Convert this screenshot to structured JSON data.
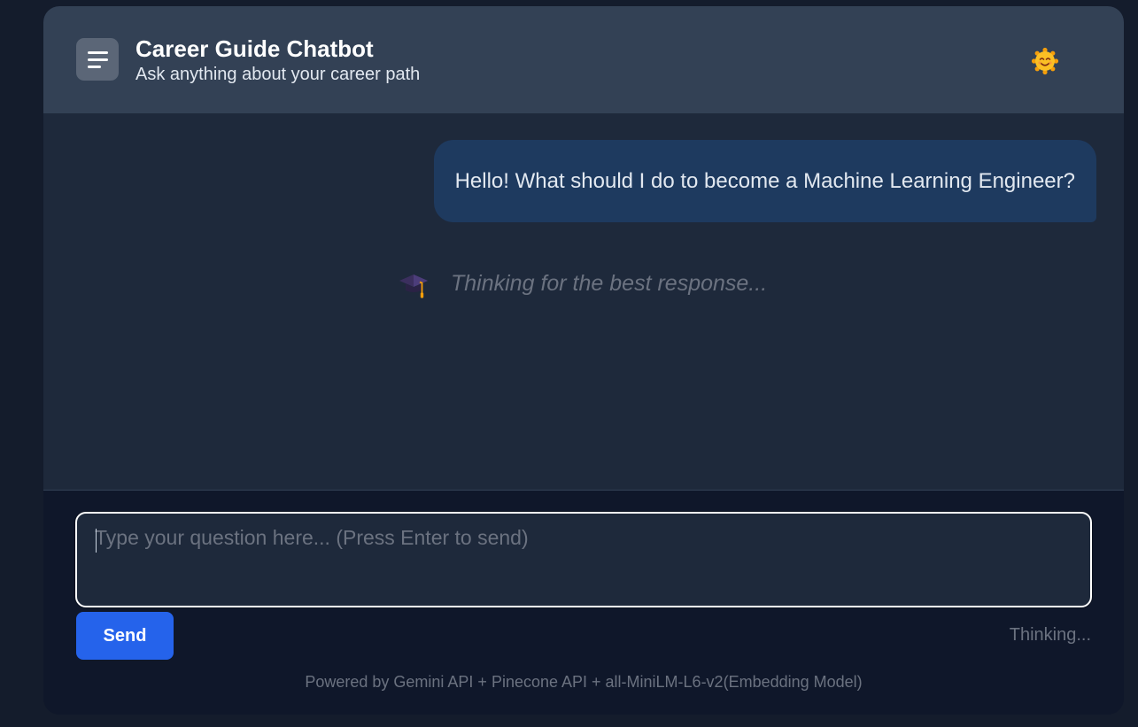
{
  "header": {
    "menu_icon": "hamburger-menu-icon",
    "title": "Career Guide Chatbot",
    "subtitle": "Ask anything about your career path",
    "theme_icon": "smiling-sun-icon"
  },
  "chat": {
    "messages": [
      {
        "role": "user",
        "text": "Hello! What should I do to become a Machine Learning Engineer?"
      }
    ],
    "thinking": {
      "icon": "graduation-cap-icon",
      "text": "Thinking for the best response..."
    }
  },
  "input": {
    "placeholder": "Type your question here... (Press Enter to send)",
    "value": ""
  },
  "send_label": "Send",
  "status": "Thinking...",
  "footer": "Powered by Gemini API + Pinecone API + all-MiniLM-L6-v2(Embedding Model)",
  "colors": {
    "page_bg": "#141c2c",
    "app_bg": "#0f172a",
    "header_bg": "#334155",
    "chat_bg": "#1e293b",
    "user_bubble_bg": "#1e3a5f",
    "accent": "#2563eb",
    "muted_text": "#6b7280"
  }
}
